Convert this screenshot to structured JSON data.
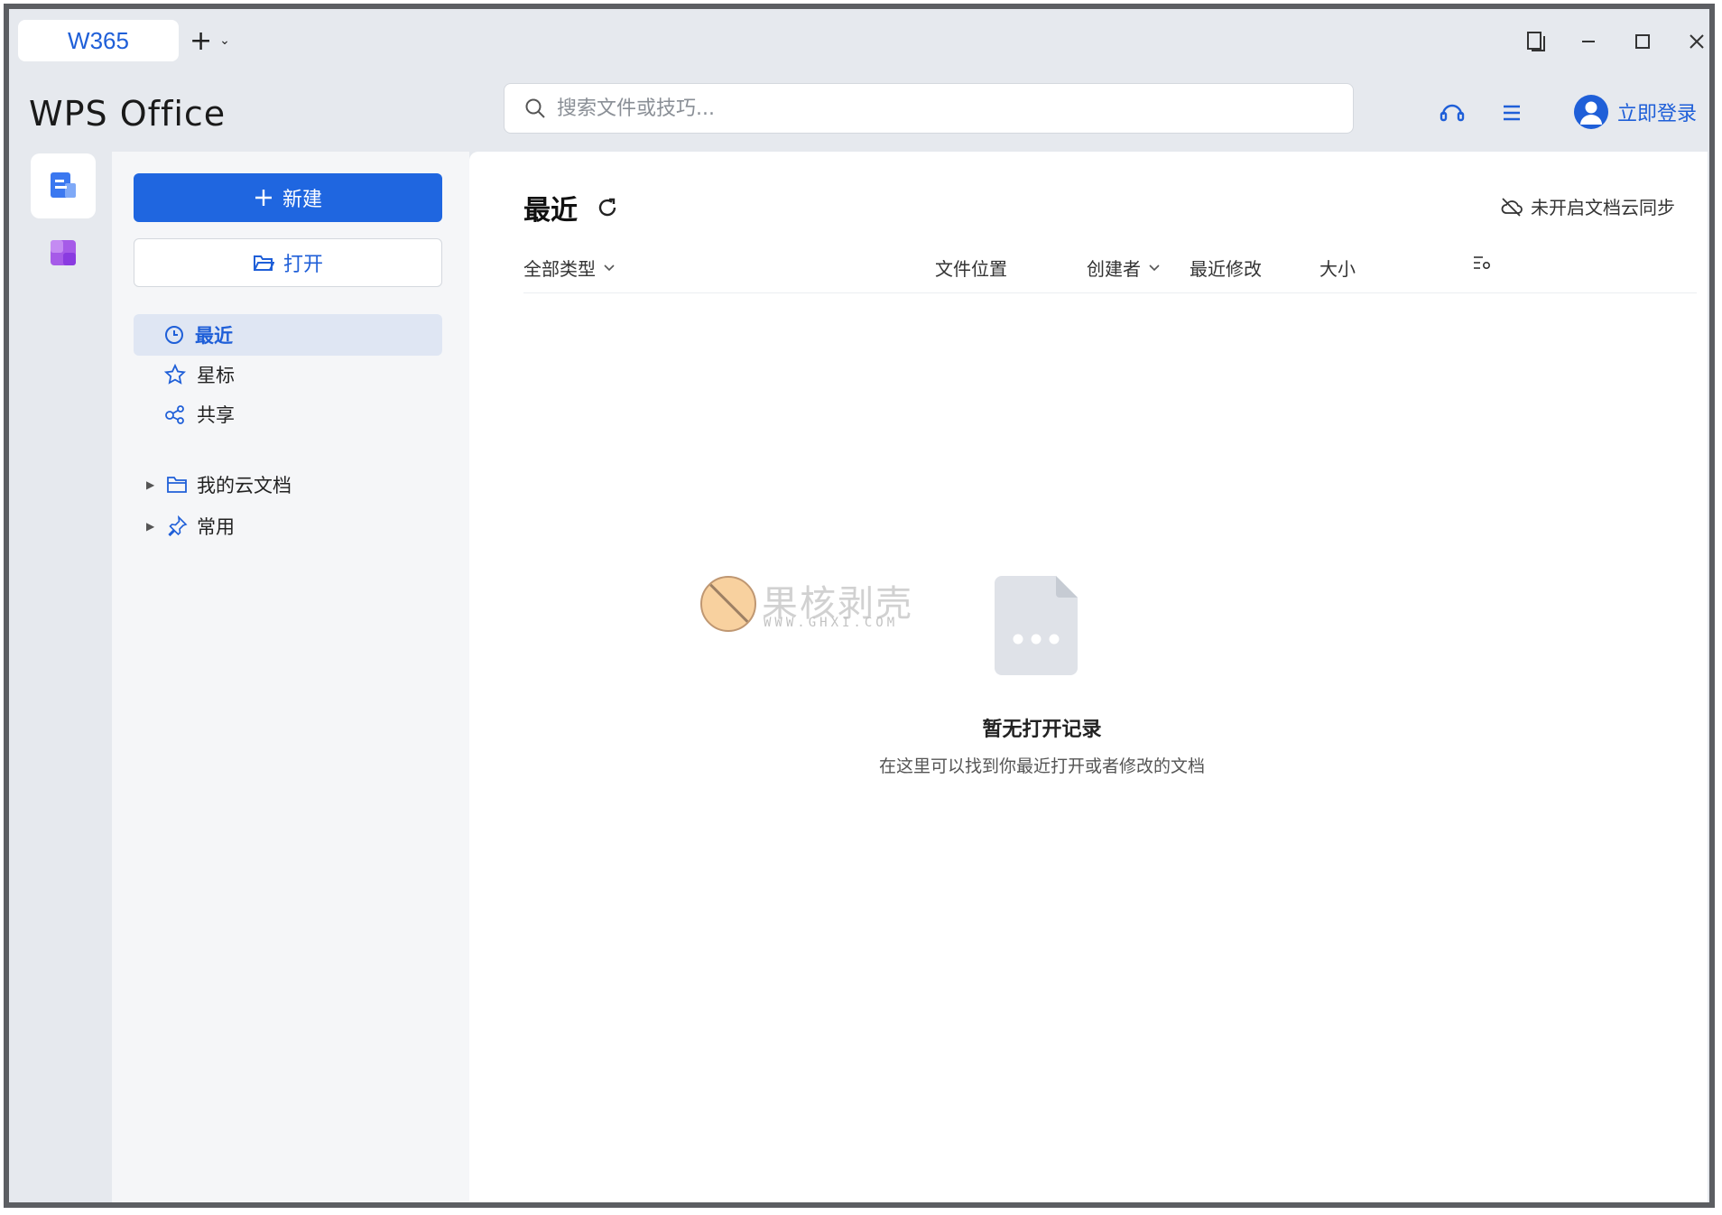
{
  "titlebar": {
    "tab_label": "W365",
    "new_tab_symbol": "+",
    "new_tab_chevron": "⌄"
  },
  "header": {
    "logo": "WPS Office",
    "search_placeholder": "搜索文件或技巧...",
    "login_label": "立即登录"
  },
  "sidebar": {
    "new_button": "新建",
    "open_button": "打开",
    "nav": [
      {
        "label": "最近",
        "icon": "clock-icon",
        "active": true
      },
      {
        "label": "星标",
        "icon": "star-icon",
        "active": false
      },
      {
        "label": "共享",
        "icon": "share-icon",
        "active": false
      }
    ],
    "tree": [
      {
        "label": "我的云文档",
        "icon": "folder-icon"
      },
      {
        "label": "常用",
        "icon": "pin-icon"
      }
    ]
  },
  "main": {
    "title": "最近",
    "sync_status": "未开启文档云同步",
    "columns": {
      "type": "全部类型",
      "location": "文件位置",
      "creator": "创建者",
      "modified": "最近修改",
      "size": "大小"
    },
    "empty_title": "暂无打开记录",
    "empty_subtitle": "在这里可以找到你最近打开或者修改的文档"
  },
  "watermark": {
    "title": "果核剥壳",
    "url": "WWW.GHXI.COM"
  },
  "colors": {
    "accent": "#1f66e0",
    "sidebar_bg": "#f5f6f8",
    "frame_bg": "#e6e9ee"
  }
}
